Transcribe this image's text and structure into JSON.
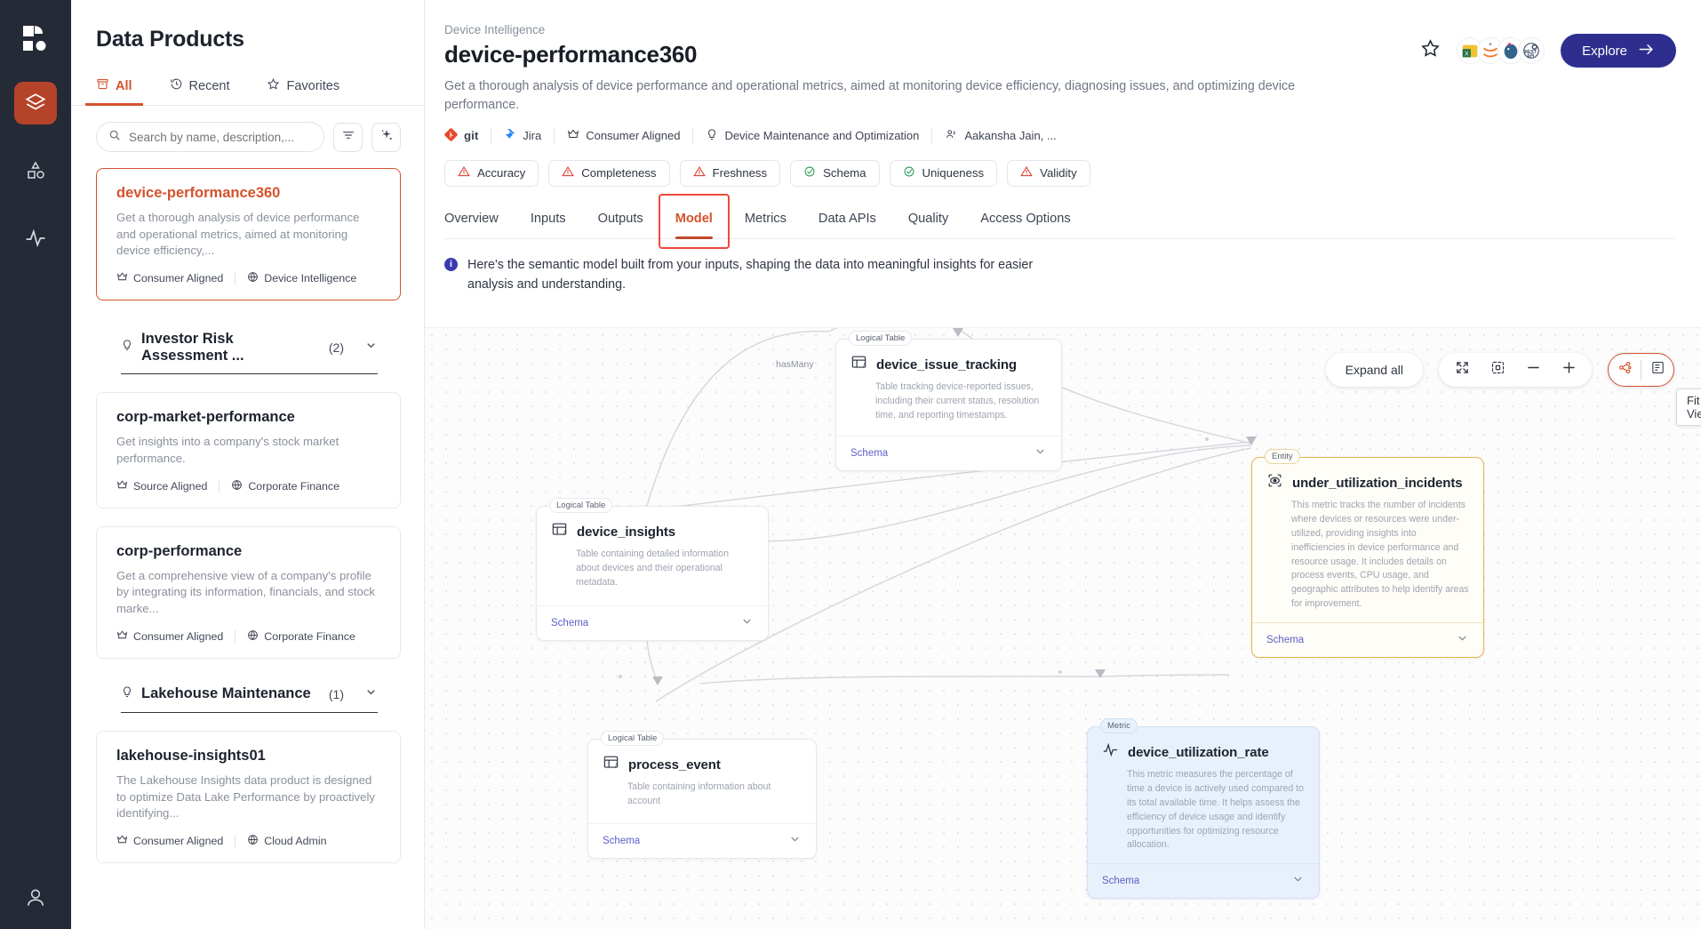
{
  "rail": {
    "logo_icon": "app-logo-icon",
    "items": [
      {
        "icon": "layers-icon",
        "name": "data-products",
        "active": true
      },
      {
        "icon": "shapes-icon",
        "name": "entities",
        "active": false
      },
      {
        "icon": "activity-icon",
        "name": "metrics",
        "active": false
      }
    ],
    "bottom": {
      "icon": "user-account-icon",
      "name": "account"
    }
  },
  "panel": {
    "title": "Data Products",
    "tabs": [
      {
        "label": "All",
        "icon": "archive-icon",
        "active": true
      },
      {
        "label": "Recent",
        "icon": "history-icon",
        "active": false
      },
      {
        "label": "Favorites",
        "icon": "star-icon",
        "active": false
      }
    ],
    "search": {
      "placeholder": "Search by name, description,...",
      "value": ""
    },
    "filter_icon": "filter-icon",
    "ai_icon": "sparkle-icon",
    "cards": [
      {
        "title": "device-performance360",
        "desc": "Get a thorough analysis of device performance and operational metrics, aimed at monitoring device efficiency,...",
        "alignment": "Consumer Aligned",
        "domain": "Device Intelligence",
        "selected": true
      },
      {
        "title": "corp-market-performance",
        "desc": "Get insights into a company's stock market performance.",
        "alignment": "Source Aligned",
        "domain": "Corporate Finance",
        "selected": false
      },
      {
        "title": "corp-performance",
        "desc": "Get a comprehensive view of a company's profile by integrating its information, financials, and stock marke...",
        "alignment": "Consumer Aligned",
        "domain": "Corporate Finance",
        "selected": false
      },
      {
        "title": "lakehouse-insights01",
        "desc": "The Lakehouse Insights data product is designed to optimize Data Lake Performance by proactively identifying...",
        "alignment": "Consumer Aligned",
        "domain": "Cloud Admin",
        "selected": false
      }
    ],
    "groups": [
      {
        "name": "Investor Risk Assessment ...",
        "count": "(2)"
      },
      {
        "name": "Lakehouse Maintenance",
        "count": "(1)"
      }
    ]
  },
  "header": {
    "breadcrumb": "Device Intelligence",
    "title": "device-performance360",
    "description": "Get a thorough analysis of device performance and operational metrics, aimed at monitoring device efficiency, diagnosing issues, and optimizing device performance.",
    "meta": [
      {
        "label": "git",
        "icon": "git-icon"
      },
      {
        "label": "Jira",
        "icon": "jira-icon"
      },
      {
        "label": "Consumer Aligned",
        "icon": "crown-icon"
      },
      {
        "label": "Device Maintenance and Optimization",
        "icon": "bulb-icon"
      },
      {
        "label": "Aakansha Jain, ...",
        "icon": "people-icon"
      }
    ],
    "badges": [
      {
        "label": "Accuracy",
        "status": "warning"
      },
      {
        "label": "Completeness",
        "status": "warning"
      },
      {
        "label": "Freshness",
        "status": "warning"
      },
      {
        "label": "Schema",
        "status": "ok"
      },
      {
        "label": "Uniqueness",
        "status": "ok"
      },
      {
        "label": "Validity",
        "status": "warning"
      }
    ],
    "star_icon": "favorite-star-icon",
    "avatars": [
      "excel-avatar",
      "jupyter-avatar",
      "postgres-avatar",
      "restapi-avatar"
    ],
    "explore_label": "Explore",
    "explore_arrow": "→",
    "colors": {
      "accent": "#d4532c",
      "explore_bg": "#2e2e8f",
      "warning": "#d93025",
      "ok": "#2a9d54"
    }
  },
  "tabs": [
    {
      "label": "Overview",
      "active": false
    },
    {
      "label": "Inputs",
      "active": false
    },
    {
      "label": "Outputs",
      "active": false
    },
    {
      "label": "Model",
      "active": true,
      "highlighted": true
    },
    {
      "label": "Metrics",
      "active": false
    },
    {
      "label": "Data APIs",
      "active": false
    },
    {
      "label": "Quality",
      "active": false
    },
    {
      "label": "Access Options",
      "active": false
    }
  ],
  "info_banner": {
    "icon": "info-icon",
    "text": "Here's the semantic model built from your inputs, shaping the data into meaningful insights for easier analysis and understanding."
  },
  "canvas": {
    "toolbar": {
      "expand_all": "Expand all",
      "fullscreen_icon": "fullscreen-icon",
      "fit_view_icon": "fit-view-icon",
      "zoom_out_icon": "minus-icon",
      "zoom_in_icon": "plus-icon",
      "graph_view_icon": "graph-view-icon",
      "list_view_icon": "list-view-icon"
    },
    "tooltip": "Fit View",
    "edge_labels": [
      {
        "text": "hasMany"
      }
    ],
    "schema_label": "Schema",
    "nodes": [
      {
        "id": "device_issue_tracking",
        "tag": "Logical Table",
        "name": "device_issue_tracking",
        "desc": "Table tracking device-reported issues, including their current status, resolution time, and reporting timestamps.",
        "type": "table",
        "icon": "table-function-icon"
      },
      {
        "id": "device_insights",
        "tag": "Logical Table",
        "name": "device_insights",
        "desc": "Table containing detailed information about devices and their operational metadata.",
        "type": "table",
        "icon": "table-function-icon"
      },
      {
        "id": "under_utilization_incidents",
        "tag": "Entity",
        "name": "under_utilization_incidents",
        "desc": "This metric tracks the number of incidents where devices or resources were under-utilized, providing insights into inefficiencies in device performance and resource usage. It includes details on process events, CPU usage, and geographic attributes to help identify areas for improvement.",
        "type": "entity",
        "icon": "entity-eye-icon"
      },
      {
        "id": "process_event",
        "tag": "Logical Table",
        "name": "process_event",
        "desc": "Table containing information about account",
        "type": "table",
        "icon": "table-function-icon"
      },
      {
        "id": "device_utilization_rate",
        "tag": "Metric",
        "name": "device_utilization_rate",
        "desc": "This metric measures the percentage of time a device is actively used compared to its total available time. It helps assess the efficiency of device usage and identify opportunities for optimizing resource allocation.",
        "type": "metric",
        "icon": "metric-wave-icon"
      }
    ]
  }
}
